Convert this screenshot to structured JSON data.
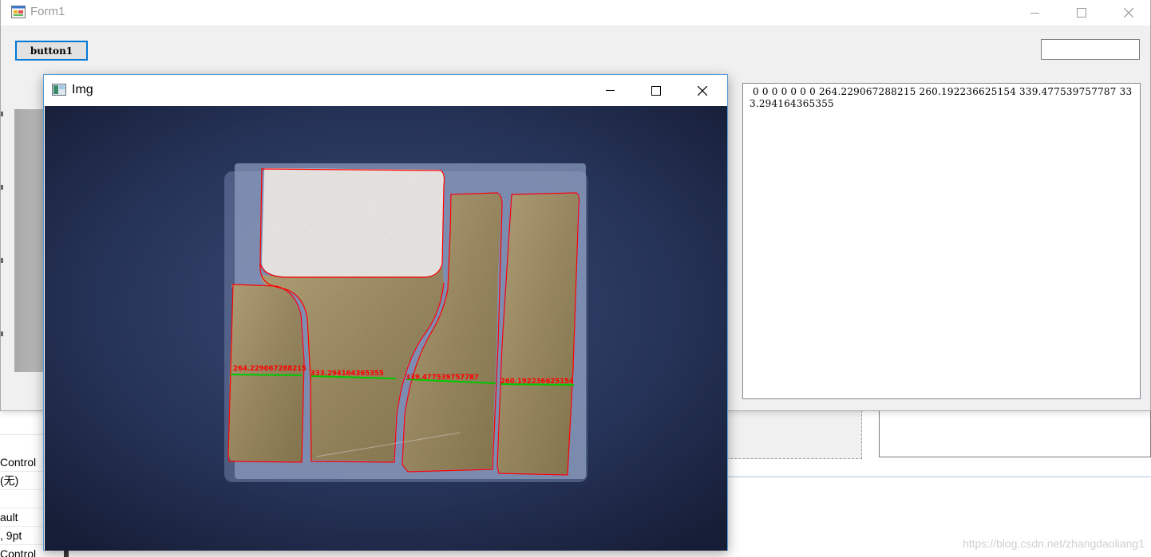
{
  "form1": {
    "title": "Form1",
    "button1_label": "button1",
    "textbox_output": " 0 0 0 0 0 0 0 264.229067288215 260.192236625154 339.477539757787 333.294164365355"
  },
  "img_window": {
    "title": "Img",
    "measurements": [
      "264.229067288215",
      "333.294164365355",
      "339.477539757787",
      "260.192236625154"
    ]
  },
  "background_panel": {
    "labels": [
      "Control",
      "(无)",
      "",
      "ault",
      ", 9pt",
      "Control"
    ]
  },
  "watermark": "https://blog.csdn.net/zhangdaoliang1",
  "icons": {
    "form_icon": "winform-app-icon",
    "img_icon": "image-window-icon",
    "minimize": "minimize-icon",
    "maximize": "maximize-icon",
    "close": "close-icon"
  },
  "colors": {
    "contour": "#ff0000",
    "measure_line": "#00c800",
    "button_focus": "#0078d7"
  }
}
